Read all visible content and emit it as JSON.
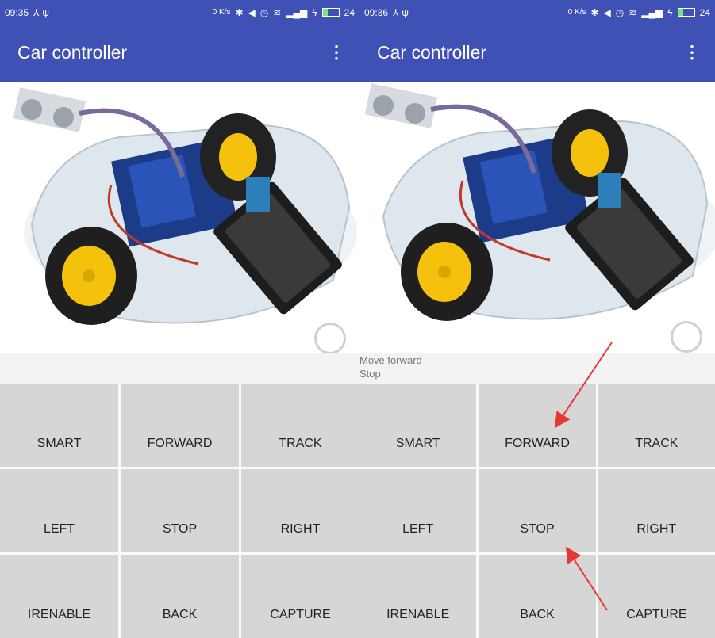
{
  "left": {
    "status_time": "09:35",
    "battery_level": "24",
    "app_title": "Car controller",
    "log_lines": []
  },
  "right": {
    "status_time": "09:36",
    "battery_level": "24",
    "app_title": "Car controller",
    "log_lines": [
      "Move forward",
      "Stop"
    ]
  },
  "status_icons": [
    "usb-share-icon",
    "usb-icon",
    "data-speed-icon",
    "bluetooth-icon",
    "volume-icon",
    "alarm-icon",
    "wifi-icon",
    "signal-icon",
    "charging-icon",
    "battery-icon"
  ],
  "data_speed_label": "0 K/s",
  "buttons": [
    "SMART",
    "FORWARD",
    "TRACK",
    "LEFT",
    "STOP",
    "RIGHT",
    "IRENABLE",
    "BACK",
    "CAPTURE"
  ],
  "colors": {
    "appbar": "#3f51b5",
    "button_bg": "#d6d6d6",
    "annotation_arrow": "#e53935"
  }
}
